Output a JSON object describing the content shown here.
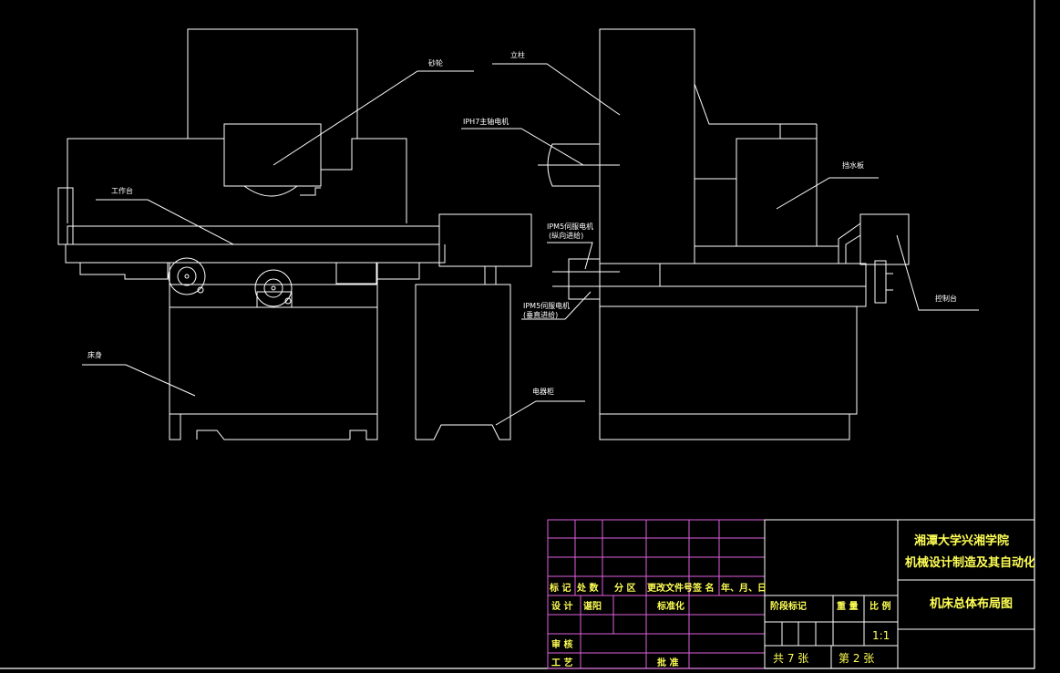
{
  "colors": {
    "background": "#000000",
    "linework": "#ffffff",
    "title_block_grid": "#e060e0",
    "title_block_text": "#ffff55"
  },
  "labels": {
    "grinding_wheel": "砂轮",
    "column": "立柱",
    "spindle_motor": "IPH7主轴电机",
    "worktable": "工作台",
    "servo_motor_longitudinal_1": "IPM5伺服电机",
    "servo_motor_longitudinal_2": "(纵向进给)",
    "servo_motor_vertical_1": "IPM5伺服电机",
    "servo_motor_vertical_2": "(垂直进给)",
    "guard_plate": "挡水板",
    "control_console": "控制台",
    "bed": "床身",
    "electrical_cabinet": "电器柜"
  },
  "title_block": {
    "school_line1": "湘潭大学兴湘学院",
    "school_line2": "机械设计制造及其自动化",
    "drawing_title": "机床总体布局图",
    "rev_mark": "标 记",
    "rev_count": "处 数",
    "rev_zone": "分 区",
    "rev_doc": "更改文件号",
    "rev_sign": "签 名",
    "rev_date": "年、月、日",
    "design": "设 计",
    "designer": "谌阳",
    "standardize": "标准化",
    "stage_mark": "阶段标记",
    "weight": "重 量",
    "scale": "比 例",
    "scale_value": "1:1",
    "review": "审 核",
    "process": "工 艺",
    "approve": "批 准",
    "sheets_total": "共 7 张",
    "sheet_number": "第 2 张"
  }
}
